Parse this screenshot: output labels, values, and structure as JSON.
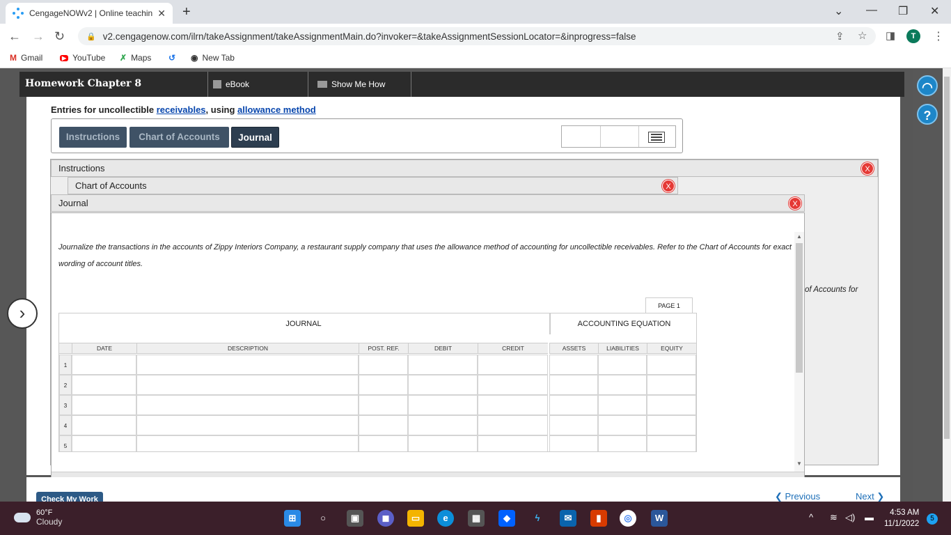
{
  "browser": {
    "tab_title": "CengageNOWv2 | Online teachin",
    "url": "v2.cengagenow.com/ilrn/takeAssignment/takeAssignmentMain.do?invoker=&takeAssignmentSessionLocator=&inprogress=false",
    "profile_initial": "T",
    "bookmarks": [
      "Gmail",
      "YouTube",
      "Maps",
      "New Tab"
    ]
  },
  "header": {
    "assignment_title": "Homework Chapter 8",
    "ebook_label": "eBook",
    "show_me_how_label": "Show Me How"
  },
  "content": {
    "title_prefix": "Entries for uncollectible ",
    "title_link1": "receivables",
    "title_mid": ", using ",
    "title_link2": "allowance method",
    "tabs": [
      "Instructions",
      "Chart of Accounts",
      "Journal"
    ],
    "active_tab": "Journal"
  },
  "panels": {
    "instructions_title": "Instructions",
    "chart_title": "Chart of Accounts",
    "journal_title": "Journal",
    "close_label": "X",
    "side_text": "of Accounts for"
  },
  "journal": {
    "instructions_text": "Journalize the transactions in the accounts of Zippy Interiors Company, a restaurant supply company that uses the allowance method of accounting for uncollectible receivables. Refer to the Chart of Accounts for exact wording of account titles.",
    "page_label": "PAGE 1",
    "section_journal": "JOURNAL",
    "section_equation": "ACCOUNTING EQUATION",
    "columns": [
      "DATE",
      "DESCRIPTION",
      "POST. REF.",
      "DEBIT",
      "CREDIT",
      "ASSETS",
      "LIABILITIES",
      "EQUITY"
    ],
    "row_numbers": [
      "1",
      "2",
      "3",
      "4",
      "5"
    ]
  },
  "footer": {
    "check_label": "Check My Work",
    "previous_label": "Previous",
    "next_label": "Next"
  },
  "taskbar": {
    "temperature": "60°F",
    "weather": "Cloudy",
    "time": "4:53 AM",
    "date": "11/1/2022",
    "notifications": "5"
  }
}
